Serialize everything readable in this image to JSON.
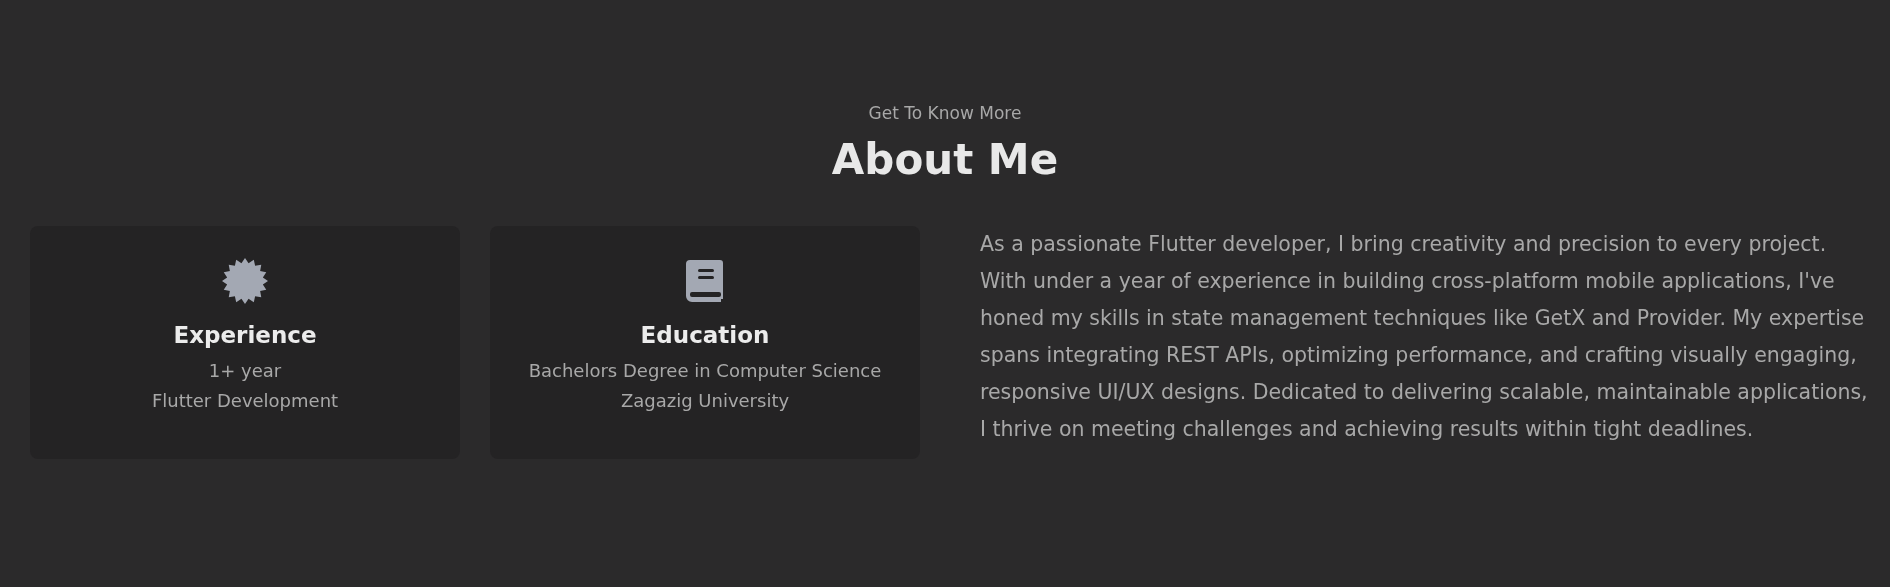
{
  "section": {
    "subtitle": "Get To Know More",
    "title": "About Me"
  },
  "cards": [
    {
      "kind": "experience",
      "title": "Experience",
      "lines": [
        "1+ year",
        "Flutter Development"
      ]
    },
    {
      "kind": "education",
      "title": "Education",
      "lines": [
        "Bachelors Degree in Computer Science",
        "Zagazig University"
      ]
    }
  ],
  "paragraph": "As a passionate Flutter developer, I bring creativity and precision to every project. With under a year of experience in building cross-platform mobile applications, I've honed my skills in state management techniques like GetX and Provider. My expertise spans integrating REST APIs, optimizing performance, and crafting visually engaging, responsive UI/UX designs. Dedicated to delivering scalable, maintainable applications, I thrive on meeting challenges and achieving results within tight deadlines."
}
